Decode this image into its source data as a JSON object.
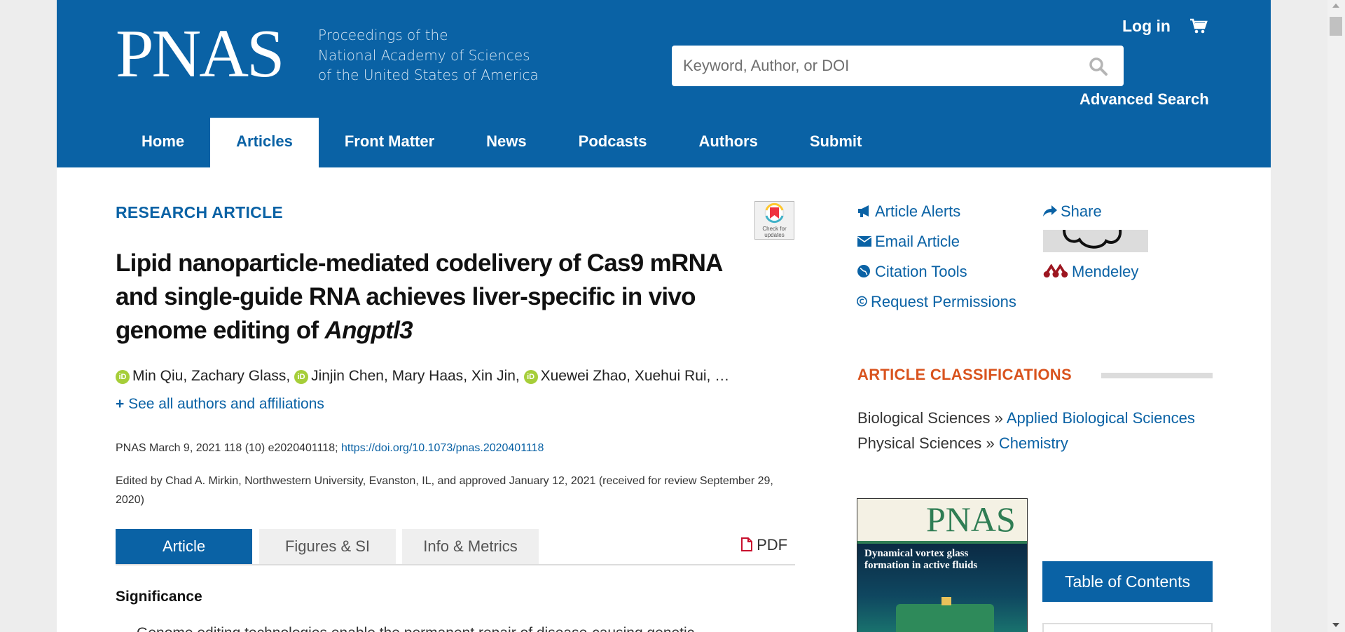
{
  "header": {
    "logo": "PNAS",
    "tagline": [
      "Proceedings of the",
      "National Academy of Sciences",
      "of the United States of America"
    ],
    "login_label": "Log in",
    "search_placeholder": "Keyword, Author, or DOI",
    "advanced_search_label": "Advanced Search",
    "brand_color": "#0a62a5"
  },
  "nav": {
    "items": [
      {
        "label": "Home",
        "active": false
      },
      {
        "label": "Articles",
        "active": true
      },
      {
        "label": "Front Matter",
        "active": false
      },
      {
        "label": "News",
        "active": false
      },
      {
        "label": "Podcasts",
        "active": false
      },
      {
        "label": "Authors",
        "active": false
      },
      {
        "label": "Submit",
        "active": false
      }
    ]
  },
  "article": {
    "type_label": "RESEARCH ARTICLE",
    "check_updates_label": "Check for updates",
    "title_main": "Lipid nanoparticle-mediated codelivery of Cas9 mRNA and single-guide RNA achieves liver-specific in vivo genome editing of ",
    "title_italic": "Angptl3",
    "authors": [
      {
        "name": "Min Qiu",
        "orcid": true
      },
      {
        "name": "Zachary Glass",
        "orcid": false
      },
      {
        "name": "Jinjin Chen",
        "orcid": true
      },
      {
        "name": "Mary Haas",
        "orcid": false
      },
      {
        "name": "Xin Jin",
        "orcid": false
      },
      {
        "name": "Xuewei Zhao",
        "orcid": true
      },
      {
        "name": "Xuehui Rui",
        "orcid": false
      }
    ],
    "authors_ellipsis": "…",
    "see_all_label": "See all authors and affiliations",
    "citation_text": "PNAS March 9, 2021 118 (10) e2020401118; ",
    "doi_link": "https://doi.org/10.1073/pnas.2020401118",
    "edited_text": "Edited by Chad A. Mirkin, Northwestern University, Evanston, IL, and approved January 12, 2021 (received for review September 29, 2020)",
    "tabs": [
      "Article",
      "Figures & SI",
      "Info & Metrics"
    ],
    "pdf_label": "PDF",
    "significance_heading": "Significance",
    "significance_first_line": "Genome editing technologies enable the permanent repair of disease-causing genetic"
  },
  "sidebar": {
    "tools_left": [
      {
        "label": "Article Alerts",
        "icon": "megaphone-icon"
      },
      {
        "label": "Email Article",
        "icon": "envelope-icon"
      },
      {
        "label": "Citation Tools",
        "icon": "globe-icon"
      },
      {
        "label": "Request Permissions",
        "icon": "copyright-icon"
      }
    ],
    "tools_right": [
      {
        "label": "Share",
        "icon": "share-arrow-icon"
      },
      {
        "label": "Mendeley",
        "icon": "mendeley-icon"
      }
    ],
    "classifications_heading": "ARTICLE CLASSIFICATIONS",
    "classifications": [
      {
        "category": "Biological Sciences",
        "sub": "Applied Biological Sciences"
      },
      {
        "category": "Physical Sciences",
        "sub": "Chemistry"
      }
    ],
    "separator": "»",
    "cover": {
      "logo": "PNAS",
      "headline": "Dynamical vortex glass formation in active fluids"
    },
    "toc_label": "Table of Contents",
    "accent_color": "#d9531e"
  }
}
